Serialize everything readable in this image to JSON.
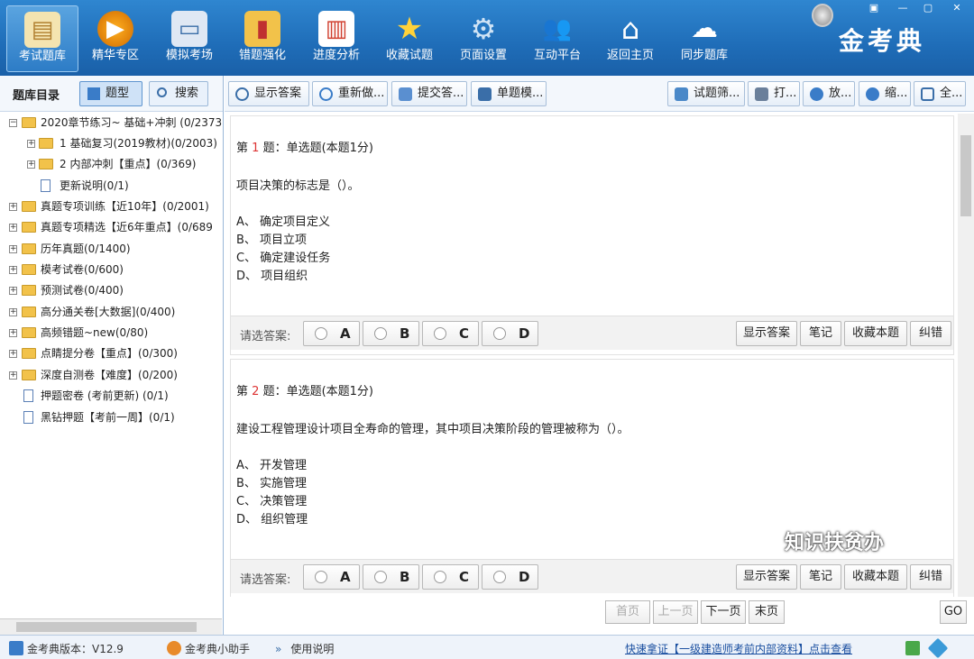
{
  "nav": {
    "items": [
      {
        "label": "考试题库",
        "icon": "exam-book-icon"
      },
      {
        "label": "精华专区",
        "icon": "play-circle-icon"
      },
      {
        "label": "模拟考场",
        "icon": "monitor-icon"
      },
      {
        "label": "错题强化",
        "icon": "chart-folder-icon"
      },
      {
        "label": "进度分析",
        "icon": "presentation-chart-icon"
      },
      {
        "label": "收藏试题",
        "icon": "star-icon"
      },
      {
        "label": "页面设置",
        "icon": "gear-icon"
      },
      {
        "label": "互动平台",
        "icon": "users-icon"
      },
      {
        "label": "返回主页",
        "icon": "home-icon"
      },
      {
        "label": "同步题库",
        "icon": "cloud-sync-icon"
      }
    ],
    "logo": "金考典",
    "win_controls": [
      "▣",
      "—",
      "▢",
      "✕"
    ]
  },
  "sidebar": {
    "title": "题库目录",
    "tab_type": "题型",
    "tab_search": "搜索",
    "tree": [
      "2020章节练习~ 基础+冲刺 (0/2373",
      "1 基础复习(2019教材)(0/2003)",
      "2 内部冲刺【重点】(0/369)",
      "更新说明(0/1)",
      "真题专项训练【近10年】(0/2001)",
      "真题专项精选【近6年重点】(0/689",
      "历年真题(0/1400)",
      "模考试卷(0/600)",
      "预测试卷(0/400)",
      "高分通关卷[大数据](0/400)",
      "高频错题~new(0/80)",
      "点睛提分卷【重点】(0/300)",
      "深度自测卷【难度】(0/200)",
      "押题密卷 (考前更新) (0/1)",
      "黑钻押题【考前一周】(0/1)"
    ]
  },
  "toolbar": {
    "show_answer": "显示答案",
    "redo": "重新做...",
    "submit": "提交答...",
    "single_mode": "单题模...",
    "filter": "试题筛...",
    "print": "打...",
    "zoom_in": "放...",
    "zoom_out": "缩...",
    "fullscreen": "全..."
  },
  "questions": [
    {
      "prefix": "第",
      "num": "1",
      "suffix": "题：单选题(本题1分)",
      "text": "项目决策的标志是（）。",
      "options": [
        "A、 确定项目定义",
        "B、 项目立项",
        "C、 确定建设任务",
        "D、 项目组织"
      ]
    },
    {
      "prefix": "第",
      "num": "2",
      "suffix": "题：单选题(本题1分)",
      "text": "建设工程管理设计项目全寿命的管理，其中项目决策阶段的管理被称为（）。",
      "options": [
        "A、 开发管理",
        "B、 实施管理",
        "C、 决策管理",
        "D、 组织管理"
      ]
    }
  ],
  "answer_bar": {
    "label": "请选答案:",
    "choices": [
      "A",
      "B",
      "C",
      "D"
    ],
    "show_answer": "显示答案",
    "notes": "笔记",
    "favorite": "收藏本题",
    "correct": "纠错"
  },
  "pager": {
    "first": "首页",
    "prev": "上一页",
    "next": "下一页",
    "last": "末页",
    "go": "GO"
  },
  "watermark": "知识扶贫办",
  "status": {
    "version": "金考典版本：V12.9",
    "assistant": "金考典小助手",
    "help": "使用说明",
    "promo": "快速拿证【一级建造师考前内部资料】点击查看"
  }
}
